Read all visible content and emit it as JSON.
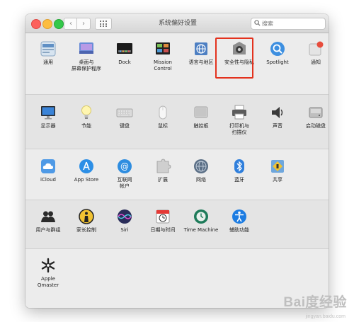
{
  "window": {
    "title": "系统偏好设置",
    "search_placeholder": "搜索",
    "nav_back": "‹",
    "nav_forward": "›"
  },
  "rows": [
    {
      "items": [
        {
          "label": "通用",
          "icon": "general-icon",
          "name": "pref-general"
        },
        {
          "label": "桌面与\n屏幕保护程序",
          "icon": "desktop-screensaver-icon",
          "name": "pref-desktop-screensaver"
        },
        {
          "label": "Dock",
          "icon": "dock-icon",
          "name": "pref-dock"
        },
        {
          "label": "Mission\nControl",
          "icon": "mission-control-icon",
          "name": "pref-mission-control"
        },
        {
          "label": "语言与地区",
          "icon": "language-region-icon",
          "name": "pref-language-region"
        },
        {
          "label": "安全性与隐私",
          "icon": "security-privacy-icon",
          "name": "pref-security-privacy"
        },
        {
          "label": "Spotlight",
          "icon": "spotlight-icon",
          "name": "pref-spotlight"
        },
        {
          "label": "通知",
          "icon": "notifications-icon",
          "name": "pref-notifications"
        }
      ]
    },
    {
      "items": [
        {
          "label": "显示器",
          "icon": "displays-icon",
          "name": "pref-displays"
        },
        {
          "label": "节能",
          "icon": "energy-saver-icon",
          "name": "pref-energy-saver"
        },
        {
          "label": "键盘",
          "icon": "keyboard-icon",
          "name": "pref-keyboard"
        },
        {
          "label": "鼠标",
          "icon": "mouse-icon",
          "name": "pref-mouse"
        },
        {
          "label": "触控板",
          "icon": "trackpad-icon",
          "name": "pref-trackpad"
        },
        {
          "label": "打印机与\n扫描仪",
          "icon": "printer-scanner-icon",
          "name": "pref-printers-scanners"
        },
        {
          "label": "声音",
          "icon": "sound-icon",
          "name": "pref-sound"
        },
        {
          "label": "启动磁盘",
          "icon": "startup-disk-icon",
          "name": "pref-startup-disk"
        }
      ]
    },
    {
      "items": [
        {
          "label": "iCloud",
          "icon": "icloud-icon",
          "name": "pref-icloud"
        },
        {
          "label": "App Store",
          "icon": "app-store-icon",
          "name": "pref-app-store"
        },
        {
          "label": "互联网\n帐户",
          "icon": "internet-accounts-icon",
          "name": "pref-internet-accounts"
        },
        {
          "label": "扩展",
          "icon": "extensions-icon",
          "name": "pref-extensions"
        },
        {
          "label": "网络",
          "icon": "network-icon",
          "name": "pref-network"
        },
        {
          "label": "蓝牙",
          "icon": "bluetooth-icon",
          "name": "pref-bluetooth"
        },
        {
          "label": "共享",
          "icon": "sharing-icon",
          "name": "pref-sharing"
        }
      ]
    },
    {
      "items": [
        {
          "label": "用户与群组",
          "icon": "users-groups-icon",
          "name": "pref-users-groups"
        },
        {
          "label": "家长控制",
          "icon": "parental-controls-icon",
          "name": "pref-parental-controls"
        },
        {
          "label": "Siri",
          "icon": "siri-icon",
          "name": "pref-siri"
        },
        {
          "label": "日期与时间",
          "icon": "date-time-icon",
          "name": "pref-date-time"
        },
        {
          "label": "Time Machine",
          "icon": "time-machine-icon",
          "name": "pref-time-machine"
        },
        {
          "label": "辅助功能",
          "icon": "accessibility-icon",
          "name": "pref-accessibility"
        }
      ]
    },
    {
      "items": [
        {
          "label": "Apple\nQmaster",
          "icon": "apple-qmaster-icon",
          "name": "pref-apple-qmaster"
        }
      ]
    }
  ],
  "watermark": {
    "text": "Bai度经验",
    "url": "jingyan.baidu.com"
  },
  "colors": {
    "highlight": "#e3321e"
  }
}
